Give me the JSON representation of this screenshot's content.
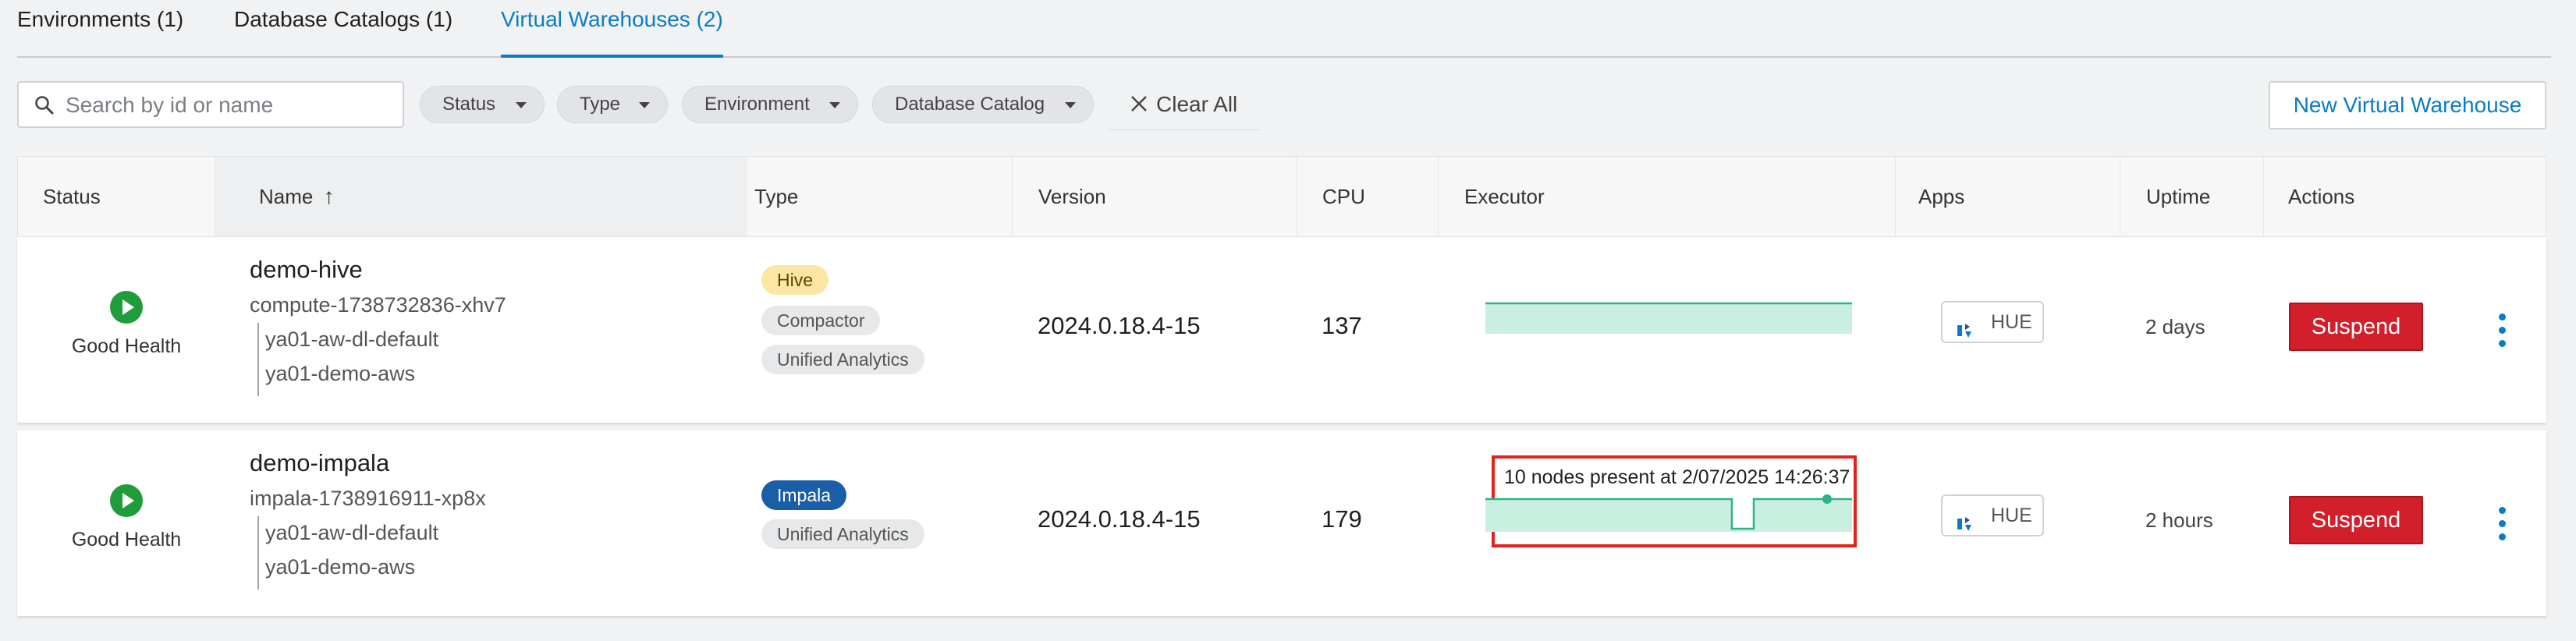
{
  "tabs": [
    {
      "label": "Environments (1)",
      "active": false
    },
    {
      "label": "Database Catalogs (1)",
      "active": false
    },
    {
      "label": "Virtual Warehouses (2)",
      "active": true
    }
  ],
  "toolbar": {
    "search_placeholder": "Search by id or name",
    "filters": [
      "Status",
      "Type",
      "Environment",
      "Database Catalog"
    ],
    "clear_all": "Clear All",
    "new_button": "New Virtual Warehouse"
  },
  "table": {
    "columns": [
      "Status",
      "Name",
      "Type",
      "Version",
      "CPU",
      "Executor",
      "Apps",
      "Uptime",
      "Actions"
    ],
    "sort_column": "Name",
    "sort_indicator": "↑",
    "rows": [
      {
        "status": "Good Health",
        "name": "demo-hive",
        "id": "compute-1738732836-xhv7",
        "environment": "ya01-aw-dl-default",
        "catalog": "ya01-demo-aws",
        "types": [
          "Hive",
          "Compactor",
          "Unified Analytics"
        ],
        "version": "2024.0.18.4-15",
        "cpu": "137",
        "app": "HUE",
        "uptime": "2 days",
        "action": "Suspend"
      },
      {
        "status": "Good Health",
        "name": "demo-impala",
        "id": "impala-1738916911-xp8x",
        "environment": "ya01-aw-dl-default",
        "catalog": "ya01-demo-aws",
        "types": [
          "Impala",
          "Unified Analytics"
        ],
        "version": "2024.0.18.4-15",
        "cpu": "179",
        "executor_tooltip": "10 nodes present at 2/07/2025 14:26:37",
        "app": "HUE",
        "uptime": "2 hours",
        "action": "Suspend"
      }
    ]
  },
  "colors": {
    "accent": "#0a7cc6",
    "healthy": "#1f9d3a",
    "suspend": "#d21f2a",
    "executor_fill": "#c8efdf",
    "executor_line": "#2bb48c",
    "highlight": "#e2231a"
  }
}
